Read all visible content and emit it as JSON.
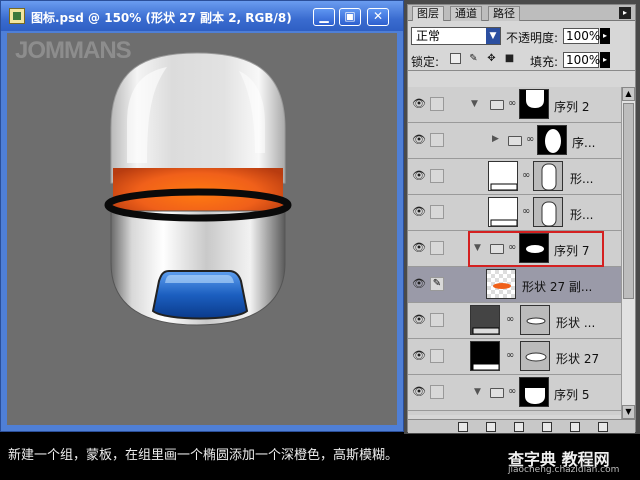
{
  "document": {
    "title": "图标.psd @ 150% (形状 27 副本 2, RGB/8)",
    "minimize_glyph": "▁",
    "maximize_glyph": "▣",
    "close_glyph": "✕",
    "watermark": "JOMMANS"
  },
  "layers_panel": {
    "tabs": [
      {
        "label": "图层",
        "active": true
      },
      {
        "label": "通道",
        "active": false
      },
      {
        "label": "路径",
        "active": false
      }
    ],
    "blend_mode": "正常",
    "opacity_label": "不透明度:",
    "opacity_value": "100%",
    "lock_label": "锁定:",
    "fill_label": "填充:",
    "fill_value": "100%",
    "layers": [
      {
        "name": "序列 2",
        "type": "group",
        "expanded": true
      },
      {
        "name": "序...",
        "type": "group",
        "expanded": false
      },
      {
        "name": "形...",
        "type": "shape"
      },
      {
        "name": "形...",
        "type": "shape"
      },
      {
        "name": "序列 7",
        "type": "group",
        "expanded": true,
        "highlighted": true
      },
      {
        "name": "形状 27 副...",
        "type": "shape",
        "selected": true
      },
      {
        "name": "形状 ...",
        "type": "shape"
      },
      {
        "name": "形状 27",
        "type": "shape"
      },
      {
        "name": "序列 5",
        "type": "group",
        "expanded": true
      }
    ]
  },
  "caption": "新建一个组，蒙板，在组里画一个椭圆添加一个深橙色，高斯模糊。",
  "site_logo": {
    "title": "查字典 教程网",
    "url": "jiaocheng.chazidian.com"
  },
  "colors": {
    "title_bar": "#3a6cd0",
    "canvas_bg": "#6e6e6e",
    "highlight_box": "#d42020",
    "orange_glow": "#f0601a",
    "blue_button": "#1c5fc0"
  }
}
